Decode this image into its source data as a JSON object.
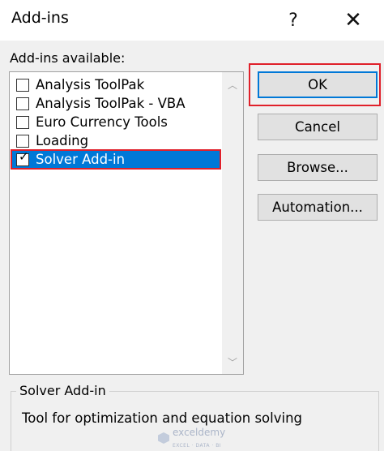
{
  "dialog": {
    "title": "Add-ins",
    "help_glyph": "?",
    "close_glyph": "✕"
  },
  "list": {
    "label": "Add-ins available:",
    "items": [
      {
        "label": "Analysis ToolPak",
        "checked": false,
        "selected": false
      },
      {
        "label": "Analysis ToolPak - VBA",
        "checked": false,
        "selected": false
      },
      {
        "label": "Euro Currency Tools",
        "checked": false,
        "selected": false
      },
      {
        "label": "Loading",
        "checked": false,
        "selected": false
      },
      {
        "label": "Solver Add-in",
        "checked": true,
        "selected": true
      }
    ]
  },
  "buttons": {
    "ok": "OK",
    "cancel": "Cancel",
    "browse": "Browse...",
    "automation": "Automation..."
  },
  "details": {
    "name": "Solver Add-in",
    "description": "Tool for optimization and equation solving"
  },
  "watermark": {
    "brand": "exceldemy",
    "tagline": "EXCEL · DATA · BI"
  },
  "colors": {
    "selection": "#0078d7",
    "highlight_annotation": "#e0202a"
  }
}
